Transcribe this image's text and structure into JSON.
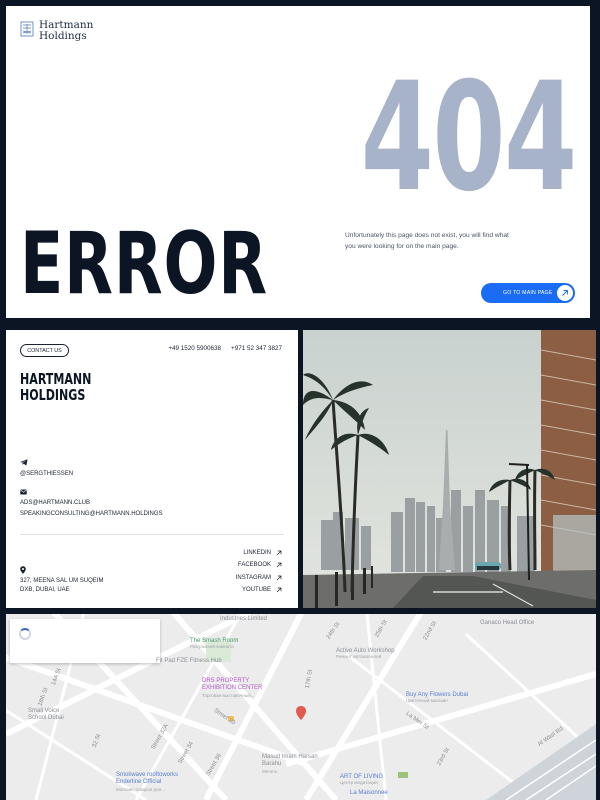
{
  "hero": {
    "logo_line1": "Hartmann",
    "logo_line2": "Holdings",
    "code": "404",
    "error_word": "ERROR",
    "message": "Unfortunately this page does not exist, you will find what you were looking for on the main page.",
    "button_label": "GO TO MAIN PAGE",
    "accent_color": "#1a6cf5",
    "code_color": "#a6b3c8"
  },
  "contact": {
    "button_label": "CONTACT US",
    "phone1": "+49 1520 5900638",
    "phone2": "+971 52 347 3827",
    "brand_line1": "HARTMANN",
    "brand_line2": "HOLDINGS",
    "telegram_handle": "@SERGTHIESSEN",
    "email1": "ADS@HARTMANN.CLUB",
    "email2": "SPEAKINGCONSULTING@HARTMANN.HOLDINGS",
    "address_line1": "327, MEENA SAL UM SUQEIM",
    "address_line2": "DXB, DUBAI, UAE",
    "socials": [
      "LINKEDIN",
      "FACEBOOK",
      "INSTAGRAM",
      "YOUTUBE"
    ],
    "icons": [
      "telegram-icon",
      "mail-icon",
      "location-pin-icon",
      "arrow-up-right-icon"
    ]
  },
  "map": {
    "labels": [
      {
        "text": "Industries Limited",
        "sub": ""
      },
      {
        "text": "The Smash Room",
        "sub": "Разгромная комната"
      },
      {
        "text": "Fit Pad FZE Fitness Hub",
        "sub": ""
      },
      {
        "text": "DRS PROPERTY EXHIBITION CENTER",
        "sub": "Торговая выставочный..."
      },
      {
        "text": "Active Auto Workshop",
        "sub": "Ремонт автомобилей"
      },
      {
        "text": "Ganaco Head Office",
        "sub": ""
      },
      {
        "text": "Buy Any Flowers Dubai",
        "sub": "Цветочный магазин"
      },
      {
        "text": "Small Voice School Dubai",
        "sub": ""
      },
      {
        "text": "Smokwave rooftoworks Enderline Official",
        "sub": "Магазин товаров для..."
      },
      {
        "text": "Masud Imam Harsan Barahu",
        "sub": "Мечеть"
      },
      {
        "text": "ART OF LIVING",
        "sub": "Центр медитации"
      },
      {
        "text": "La Maisonnee",
        "sub": ""
      }
    ],
    "streets": [
      "24th St",
      "25th St",
      "22nd St",
      "17th St",
      "14A St",
      "18th St",
      "Street 32A",
      "Street 34",
      "Street 36",
      "Street 30",
      "32 St",
      "23rd St",
      "La Mer St",
      "Al Wasl Rd"
    ]
  }
}
